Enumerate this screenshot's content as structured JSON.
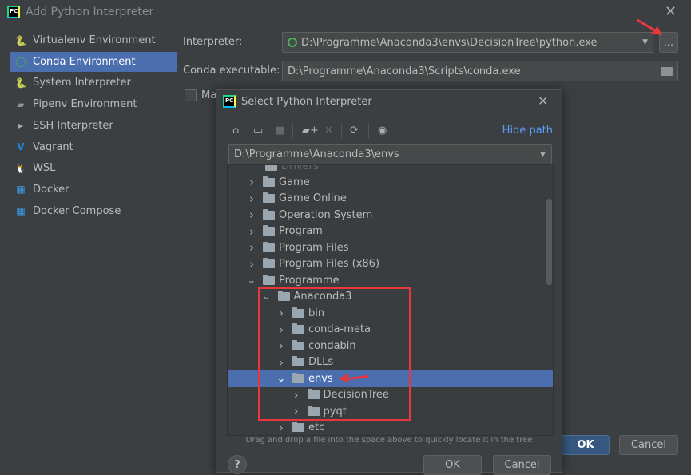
{
  "window": {
    "title": "Add Python Interpreter",
    "close_icon": "close-icon"
  },
  "sidebar": {
    "items": [
      {
        "label": "Virtualenv Environment",
        "icon": "python-virtualenv-icon"
      },
      {
        "label": "Conda Environment",
        "icon": "conda-ring-icon",
        "selected": true
      },
      {
        "label": "System Interpreter",
        "icon": "python-icon"
      },
      {
        "label": "Pipenv Environment",
        "icon": "pipenv-icon"
      },
      {
        "label": "SSH Interpreter",
        "icon": "ssh-terminal-icon"
      },
      {
        "label": "Vagrant",
        "icon": "vagrant-icon"
      },
      {
        "label": "WSL",
        "icon": "linux-penguin-icon"
      },
      {
        "label": "Docker",
        "icon": "docker-icon"
      },
      {
        "label": "Docker Compose",
        "icon": "docker-compose-icon"
      }
    ]
  },
  "form": {
    "interpreter_label": "Interpreter:",
    "interpreter_value": "D:\\Programme\\Anaconda3\\envs\\DecisionTree\\python.exe",
    "browse_label": "...",
    "conda_label": "Conda executable:",
    "conda_value": "D:\\Programme\\Anaconda3\\Scripts\\conda.exe",
    "checkbox_label": "Ma",
    "ok": "OK",
    "cancel": "Cancel"
  },
  "picker": {
    "title": "Select Python Interpreter",
    "hide_path": "Hide path",
    "path": "D:\\Programme\\Anaconda3\\envs",
    "partial_top_row": "Drivers",
    "tree": [
      {
        "label": "Game",
        "level": 1,
        "expanded": false
      },
      {
        "label": "Game Online",
        "level": 1,
        "expanded": false
      },
      {
        "label": "Operation System",
        "level": 1,
        "expanded": false
      },
      {
        "label": "Program",
        "level": 1,
        "expanded": false
      },
      {
        "label": "Program Files",
        "level": 1,
        "expanded": false
      },
      {
        "label": "Program Files (x86)",
        "level": 1,
        "expanded": false
      },
      {
        "label": "Programme",
        "level": 1,
        "expanded": true
      },
      {
        "label": "Anaconda3",
        "level": 2,
        "expanded": true
      },
      {
        "label": "bin",
        "level": 3,
        "expanded": false
      },
      {
        "label": "conda-meta",
        "level": 3,
        "expanded": false
      },
      {
        "label": "condabin",
        "level": 3,
        "expanded": false
      },
      {
        "label": "DLLs",
        "level": 3,
        "expanded": false
      },
      {
        "label": "envs",
        "level": 3,
        "expanded": true,
        "selected": true
      },
      {
        "label": "DecisionTree",
        "level": 4,
        "expanded": false
      },
      {
        "label": "pyqt",
        "level": 4,
        "expanded": false
      },
      {
        "label": "etc",
        "level": 3,
        "expanded": false
      }
    ],
    "hint": "Drag and drop a file into the space above to quickly locate it in the tree",
    "help": "?",
    "ok": "OK",
    "cancel": "Cancel"
  },
  "colors": {
    "selection": "#4b6eaf",
    "annotation": "#e8383d",
    "link": "#589df6"
  }
}
